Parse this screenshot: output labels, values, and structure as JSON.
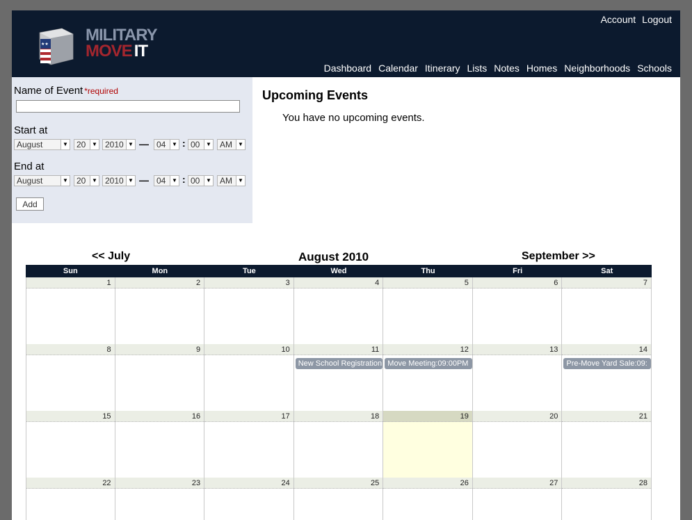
{
  "header": {
    "logo_military": "MILITARY",
    "logo_move": "MOVE",
    "logo_it": "IT",
    "top_links": [
      "Account",
      "Logout"
    ],
    "nav": [
      "Dashboard",
      "Calendar",
      "Itinerary",
      "Lists",
      "Notes",
      "Homes",
      "Neighborhoods",
      "Schools"
    ]
  },
  "form": {
    "name_label": "Name of Event",
    "required": "*required",
    "name_value": "",
    "start_label": "Start at",
    "end_label": "End at",
    "start": {
      "month": "August",
      "day": "20",
      "year": "2010",
      "hour": "04",
      "minute": "00",
      "ampm": "AM"
    },
    "end": {
      "month": "August",
      "day": "20",
      "year": "2010",
      "hour": "04",
      "minute": "00",
      "ampm": "AM"
    },
    "dash": "—",
    "colon": ":",
    "add_button": "Add"
  },
  "upcoming": {
    "title": "Upcoming Events",
    "empty": "You have no upcoming events."
  },
  "calendar": {
    "prev": "<< July",
    "title": "August 2010",
    "next": "September >>",
    "days": [
      "Sun",
      "Mon",
      "Tue",
      "Wed",
      "Thu",
      "Fri",
      "Sat"
    ],
    "weeks": [
      [
        "1",
        "2",
        "3",
        "4",
        "5",
        "6",
        "7"
      ],
      [
        "8",
        "9",
        "10",
        "11",
        "12",
        "13",
        "14"
      ],
      [
        "15",
        "16",
        "17",
        "18",
        "19",
        "20",
        "21"
      ],
      [
        "22",
        "23",
        "24",
        "25",
        "26",
        "27",
        "28"
      ]
    ],
    "today": "19",
    "events": {
      "11": "New School Registration",
      "12": "Move Meeting:09:00PM",
      "14": "Pre-Move Yard Sale:09:"
    }
  },
  "colors": {
    "header_bg": "#0c1a2e",
    "form_bg": "#e4e8f1",
    "event_bg": "#8d97a5",
    "today_bg": "#ffffe0",
    "required": "#b00000"
  }
}
